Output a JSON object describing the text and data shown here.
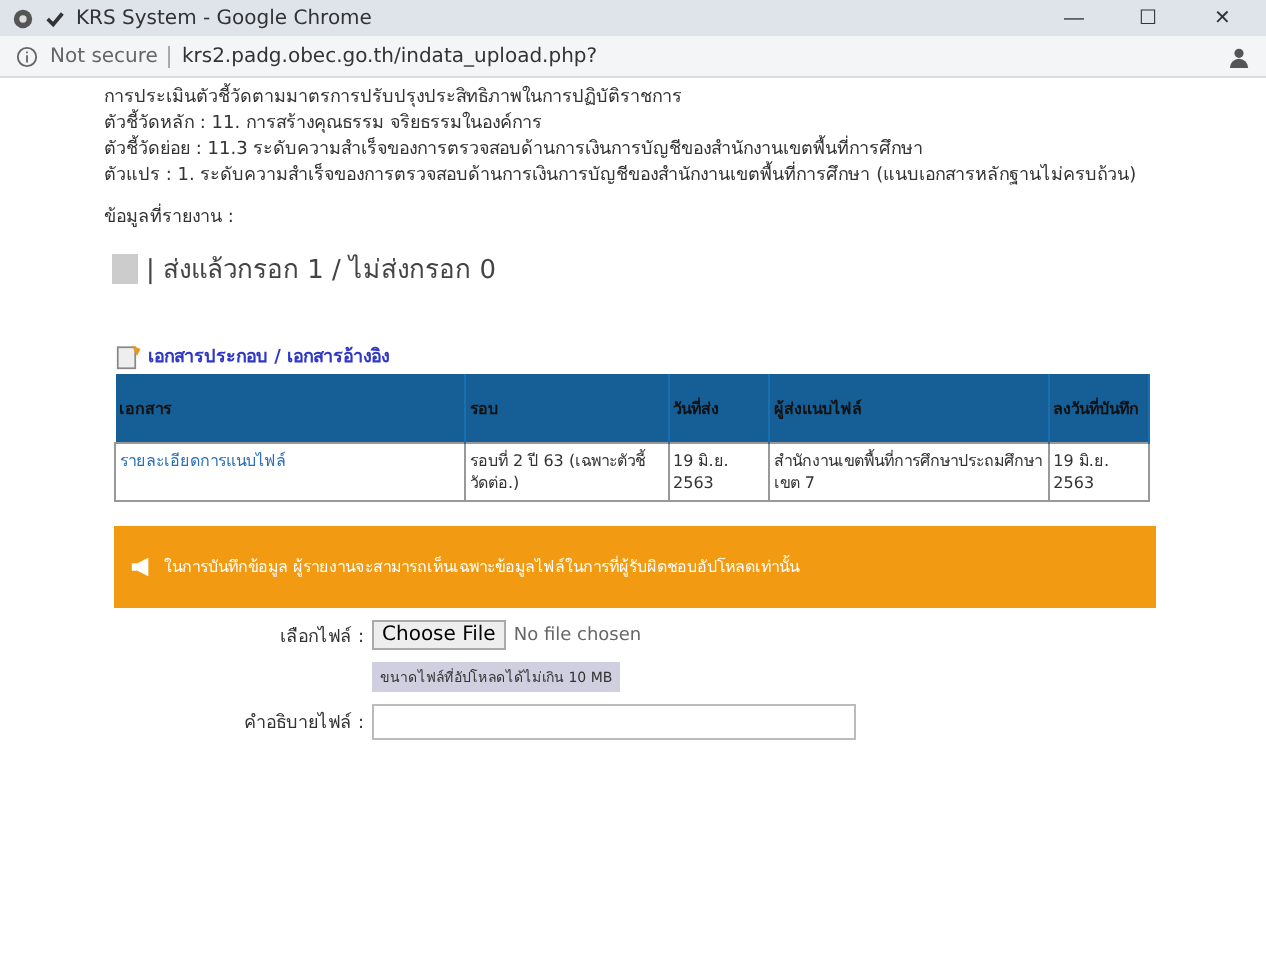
{
  "window": {
    "title": "KRS System - Google Chrome",
    "controls": [
      "—",
      "☐",
      "✕"
    ]
  },
  "address_bar": {
    "security": "Not secure",
    "url": "krs2.padg.obec.go.th/indata_upload.php?"
  },
  "info_lines": [
    "การประเมินตัวชี้วัดตามมาตรการปรับปรุงประสิทธิภาพในการปฏิบัติราชการ",
    "ตัวชี้วัดหลัก : 11. การสร้างคุณธรรม จริยธรรมในองค์การ",
    "ตัวชี้วัดย่อย : 11.3 ระดับความสำเร็จของการตรวจสอบด้านการเงินการบัญชีของสำนักงานเขตพื้นที่การศึกษา",
    "ตัวแปร : 1. ระดับความสำเร็จของการตรวจสอบด้านการเงินการบัญชีของสำนักงานเขตพื้นที่การศึกษา (แนบเอกสารหลักฐานไม่ครบถ้วน)"
  ],
  "report_label": "ข้อมูลที่รายงาน :",
  "report_value": "| ส่งแล้วกรอก 1 / ไม่ส่งกรอก 0",
  "documents": {
    "title": "เอกสารประกอบ / เอกสารอ้างอิง",
    "columns": [
      "เอกสาร",
      "รอบ",
      "วันที่ส่ง",
      "ผู้ส่งแนบไฟล์",
      "ลงวันที่บันทึก"
    ],
    "rows": [
      [
        "รายละเอียดการแนบไฟล์",
        "รอบที่ 2 ปี 63 (เฉพาะตัวชี้วัดต่อ.)",
        "19 มิ.ย. 2563",
        "สำนักงานเขตพื้นที่การศึกษาประถมศึกษา เขต 7",
        "19 มิ.ย. 2563"
      ]
    ]
  },
  "notice": "ในการบันทึกข้อมูล ผู้รายงานจะสามารถเห็นเฉพาะข้อมูลไฟล์ในการที่ผู้รับผิดชอบอัปโหลดเท่านั้น",
  "upload": {
    "file_label": "เลือกไฟล์ :",
    "button": "Choose File",
    "status": "No file chosen",
    "hint": "ขนาดไฟล์ที่อัปโหลดได้ไม่เกิน 10 MB",
    "description_label": "คำอธิบายไฟล์ :"
  }
}
